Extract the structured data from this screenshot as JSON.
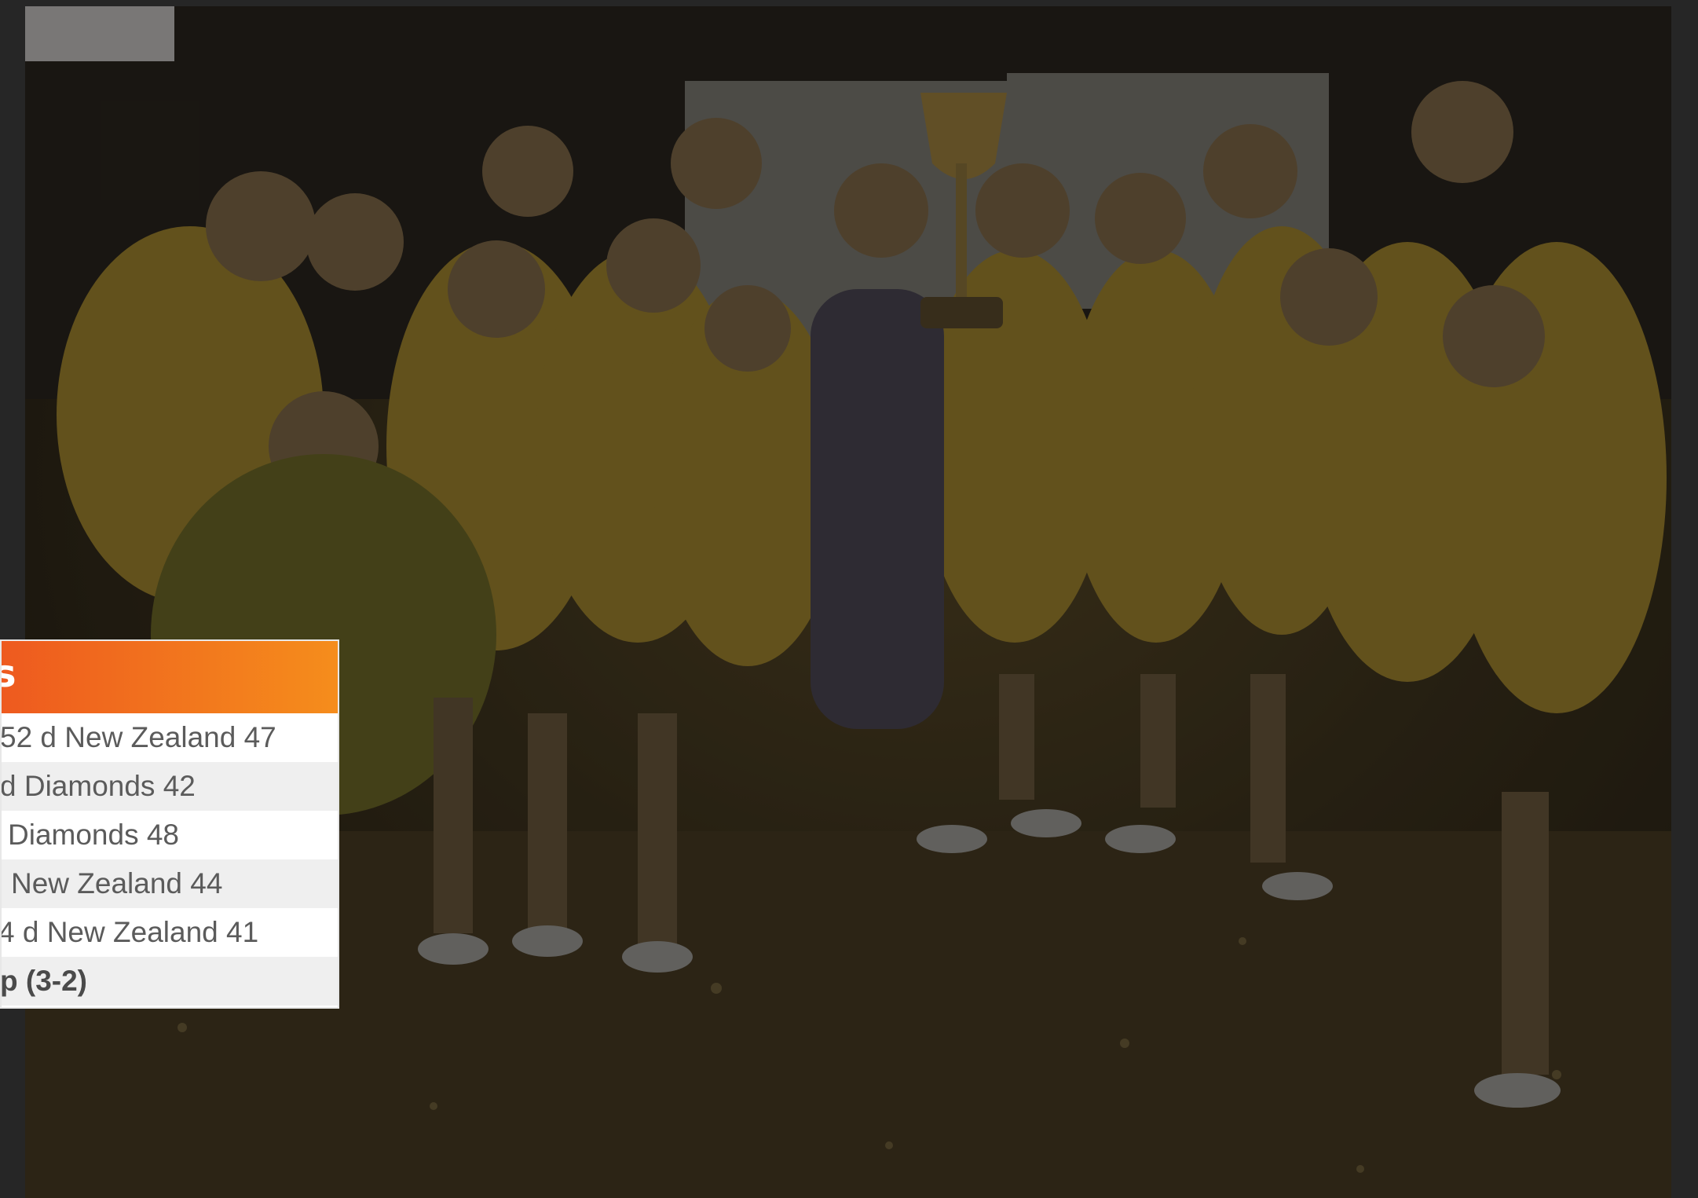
{
  "panel": {
    "title_visible": "s",
    "rows": [
      "52 d New Zealand 47",
      "d Diamonds 42",
      "Diamonds 48",
      "New Zealand 44",
      "4 d New Zealand 41"
    ],
    "summary": "p (3-2)"
  },
  "colors": {
    "header_start": "#ee5a1f",
    "header_end": "#f58d1c",
    "row_alt": "#efefef",
    "text": "#5b5b5b"
  }
}
